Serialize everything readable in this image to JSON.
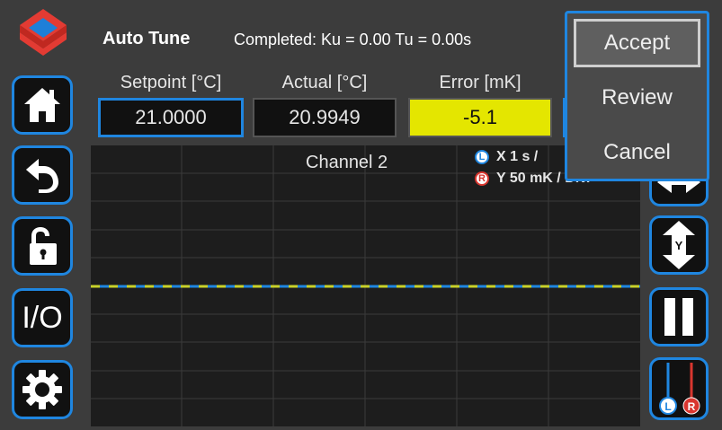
{
  "header": {
    "title": "Auto Tune",
    "status": "Completed: Ku = 0.00   Tu = 0.00s"
  },
  "fields": {
    "setpoint": {
      "label": "Setpoint [°C]",
      "value": "21.0000"
    },
    "actual": {
      "label": "Actual [°C]",
      "value": "20.9949"
    },
    "error": {
      "label": "Error [mK]",
      "value": "-5.1"
    }
  },
  "chart": {
    "title": "Channel 2",
    "legend_x": "X  1 s /",
    "legend_y": "Y  50 mK / Div.",
    "legend_x_badge": "L",
    "legend_y_badge": "R"
  },
  "menu": {
    "items": [
      "Accept",
      "Review",
      "Cancel"
    ],
    "selected": "Accept"
  },
  "sidebar": {
    "io_label": "I/O",
    "icons": [
      "logo-icon",
      "home-icon",
      "back-icon",
      "unlock-icon",
      "io-icon",
      "settings-icon"
    ]
  },
  "right_toolbar": {
    "y_label": "Y",
    "left_badge": "L",
    "right_badge": "R",
    "icons": [
      "x-scale-icon",
      "y-scale-icon",
      "pause-icon",
      "channel-select-icon"
    ]
  },
  "colors": {
    "accent": "#1f86e0",
    "error_bg": "#e4e600",
    "trace_setpoint": "#1f86e0",
    "trace_actual": "#c8d22a",
    "channel_r": "#d9362f",
    "background": "#3c3c3c"
  }
}
